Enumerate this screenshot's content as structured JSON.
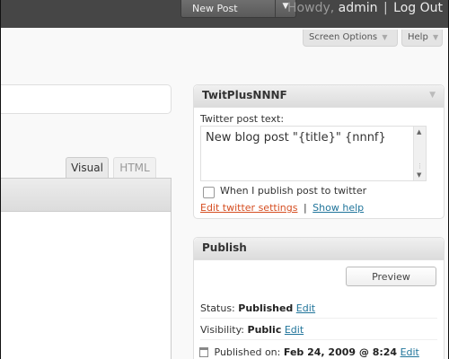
{
  "header": {
    "new_post_label": "New Post",
    "greeting": "Howdy,",
    "username": "admin",
    "separator": "|",
    "logout_label": "Log Out"
  },
  "screen_meta": {
    "screen_options_label": "Screen Options",
    "help_label": "Help"
  },
  "editor": {
    "tab_visual": "Visual",
    "tab_html": "HTML",
    "title_value": ""
  },
  "twitplus": {
    "title": "TwitPlusNNNF",
    "post_text_label": "Twitter post text:",
    "post_text_value": "New blog post \"{title}\" {nnnf}",
    "checkbox_label": "When I publish post to twitter",
    "checkbox_checked": false,
    "edit_settings_link": "Edit twitter settings",
    "link_separator": "|",
    "show_help_link": "Show help"
  },
  "publish": {
    "title": "Publish",
    "preview_label": "Preview",
    "status_label": "Status:",
    "status_value": "Published",
    "status_edit": "Edit",
    "visibility_label": "Visibility:",
    "visibility_value": "Public",
    "visibility_edit": "Edit",
    "published_on_label": "Published on:",
    "published_on_value": "Feb 24, 2009 @ 8:24",
    "published_edit": "Edit"
  },
  "icons": {
    "dropdown": "chevron-down-icon",
    "calendar": "calendar-icon"
  },
  "colors": {
    "topbar": "#464646",
    "link": "#21759b",
    "link_alt": "#d54e21"
  }
}
